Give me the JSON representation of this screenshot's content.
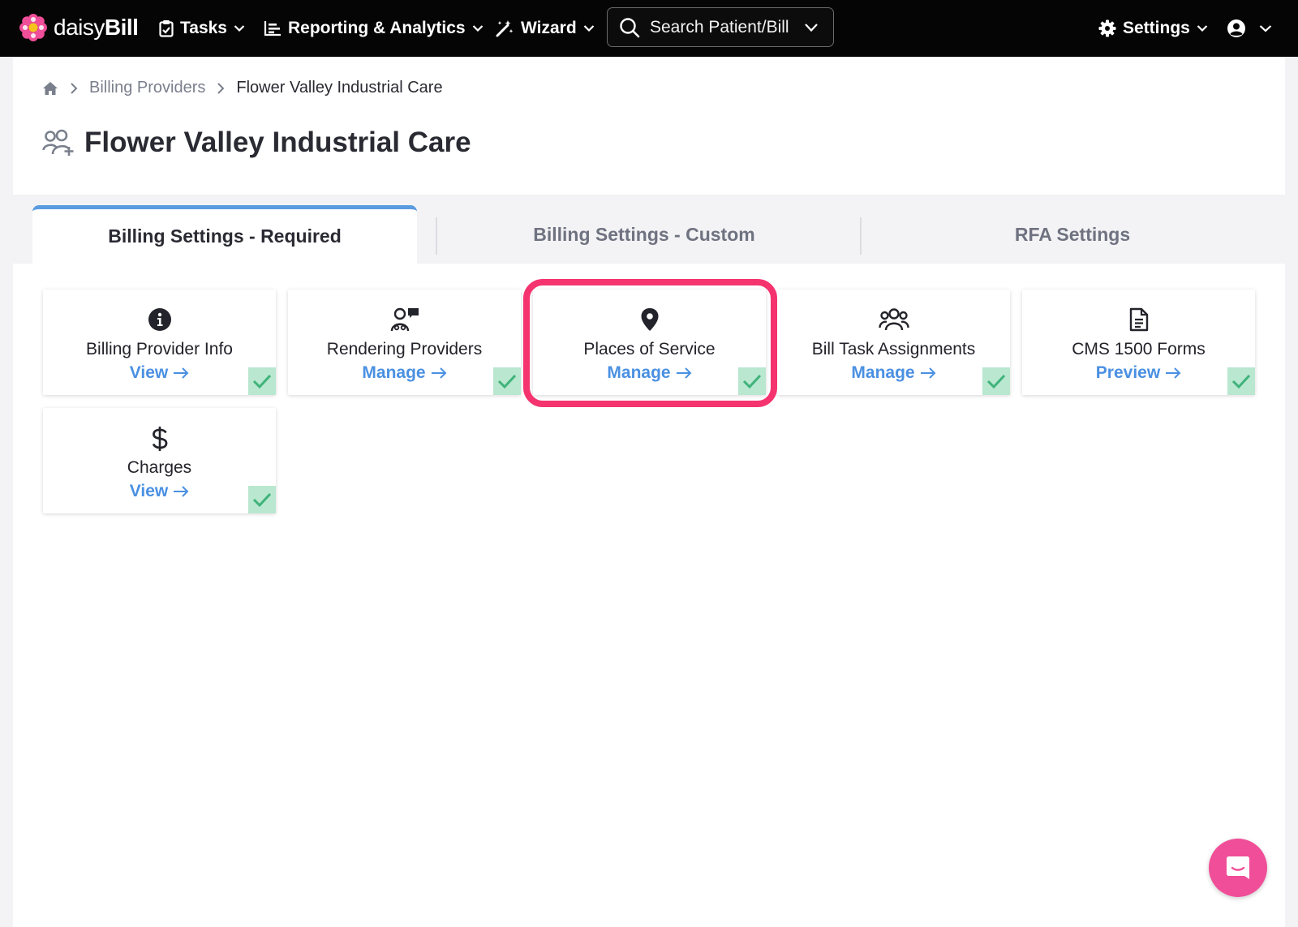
{
  "brand": {
    "daisy": "daisy",
    "bill": "Bill"
  },
  "nav": {
    "tasks": "Tasks",
    "reporting": "Reporting & Analytics",
    "wizard": "Wizard",
    "settings": "Settings"
  },
  "search": {
    "placeholder": "Search Patient/Bill"
  },
  "breadcrumb": {
    "parent": "Billing Providers",
    "current": "Flower Valley Industrial Care"
  },
  "page": {
    "title": "Flower Valley Industrial Care"
  },
  "tabs": [
    {
      "label": "Billing Settings - Required",
      "active": true
    },
    {
      "label": "Billing Settings - Custom",
      "active": false
    },
    {
      "label": "RFA Settings",
      "active": false
    }
  ],
  "cards": [
    {
      "title": "Billing Provider Info",
      "link": "View",
      "icon": "info-circle-icon",
      "complete": true
    },
    {
      "title": "Rendering Providers",
      "link": "Manage",
      "icon": "provider-chat-icon",
      "complete": true
    },
    {
      "title": "Places of Service",
      "link": "Manage",
      "icon": "map-pin-icon",
      "complete": true
    },
    {
      "title": "Bill Task Assignments",
      "link": "Manage",
      "icon": "users-icon",
      "complete": true
    },
    {
      "title": "CMS 1500 Forms",
      "link": "Preview",
      "icon": "document-icon",
      "complete": true
    },
    {
      "title": "Charges",
      "link": "View",
      "icon": "dollar-icon",
      "complete": true
    }
  ],
  "colors": {
    "accent": "#4a90e2",
    "highlight": "#f4336f",
    "check_bg": "#b9e7d0",
    "check": "#3fb37a",
    "chat": "#f04e98",
    "tab_active": "#5b9be0"
  }
}
